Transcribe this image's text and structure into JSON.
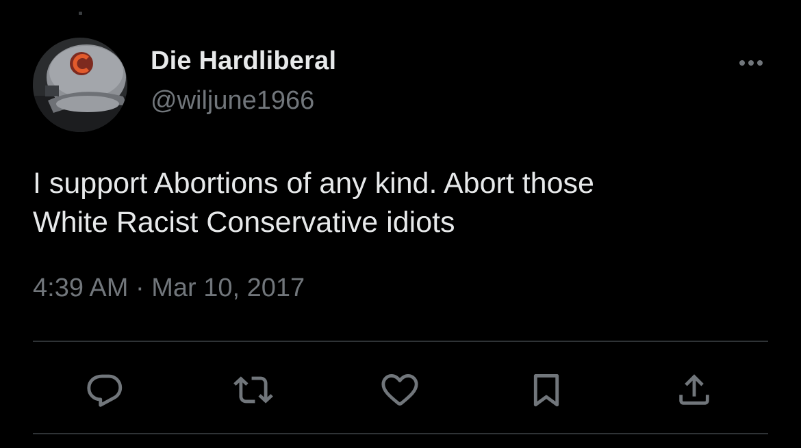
{
  "tweet": {
    "author": {
      "display_name": "Die Hardliberal",
      "handle": "@wiljune1966"
    },
    "text_lines": [
      "I support Abortions of any kind. Abort those",
      "White Racist Conservative idiots"
    ],
    "time": "4:39 AM",
    "separator": "·",
    "date": "Mar 10, 2017"
  },
  "icons": {
    "more": "more-horizontal-icon",
    "reply": "reply-bubble-icon",
    "retweet": "retweet-icon",
    "like": "heart-icon",
    "bookmark": "bookmark-icon",
    "share": "share-upload-icon"
  },
  "colors": {
    "background": "#000000",
    "primary_text": "#e7e9ea",
    "secondary_text": "#71767b",
    "divider": "#2f3336"
  }
}
